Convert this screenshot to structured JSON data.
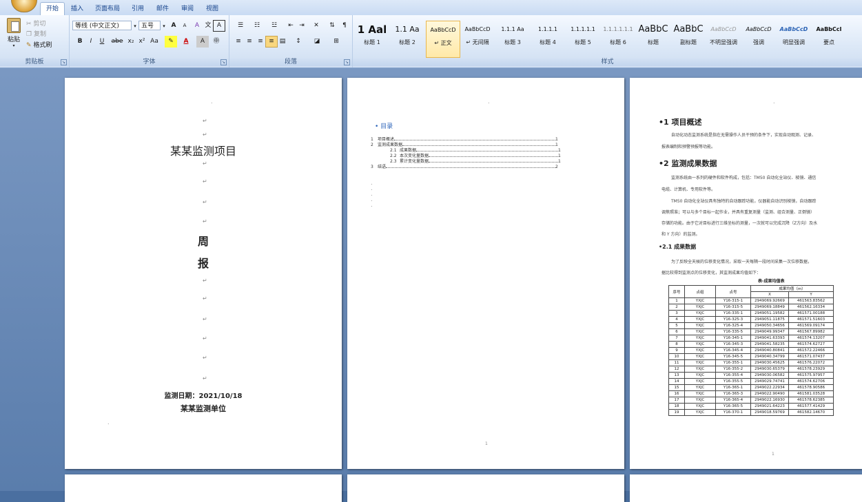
{
  "tabs": [
    "开始",
    "插入",
    "页面布局",
    "引用",
    "邮件",
    "审阅",
    "视图"
  ],
  "clipboard": {
    "paste": "粘贴",
    "cut": "剪切",
    "copy": "复制",
    "format_painter": "格式刷",
    "label": "剪贴板"
  },
  "font": {
    "name": "等线 (中文正文)",
    "size": "五号",
    "label": "字体",
    "bold": "B",
    "italic": "I",
    "underline": "U",
    "strike": "abe",
    "subscript": "x₂",
    "superscript": "x²",
    "change_case": "Aa",
    "grow": "A",
    "shrink": "A",
    "clear": "A",
    "phonetic": "文",
    "border_char": "A",
    "enclose": "A"
  },
  "paragraph": {
    "label": "段落"
  },
  "styles": {
    "label": "样式",
    "items": [
      {
        "preview": "1 Aal",
        "name": "标题 1"
      },
      {
        "preview": "1.1 Aa",
        "name": "标题 2"
      },
      {
        "preview": "AaBbCcD",
        "name": "↵ 正文"
      },
      {
        "preview": "AaBbCcD",
        "name": "↵ 无间隔"
      },
      {
        "preview": "1.1.1 Aa",
        "name": "标题 3"
      },
      {
        "preview": "1.1.1.1",
        "name": "标题 4"
      },
      {
        "preview": "1.1.1.1.1",
        "name": "标题 5"
      },
      {
        "preview": "1.1.1.1.1.1",
        "name": "标题 6"
      },
      {
        "preview": "AaBbC",
        "name": "标题"
      },
      {
        "preview": "AaBbC",
        "name": "副标题"
      },
      {
        "preview": "AaBbCcD",
        "name": "不明显强调"
      },
      {
        "preview": "AaBbCcD",
        "name": "强调"
      },
      {
        "preview": "AaBbCcD",
        "name": "明显强调"
      },
      {
        "preview": "AaBbCcI",
        "name": "要点"
      }
    ]
  },
  "cover": {
    "title": "某某监测项目",
    "big1": "周",
    "big2": "报",
    "date": "监测日期：2021/10/18",
    "org": "某某监测单位"
  },
  "toc": {
    "title": "目录",
    "rows": [
      {
        "num": "1",
        "text": "项目概述",
        "page": "1"
      },
      {
        "num": "2",
        "text": "监测成果数据",
        "page": "1"
      },
      {
        "num": "2.1",
        "text": "成果数据",
        "page": "1"
      },
      {
        "num": "2.2",
        "text": "本次变化量数据",
        "page": "1"
      },
      {
        "num": "2.3",
        "text": "累计变化量数据",
        "page": "1"
      },
      {
        "num": "3",
        "text": "结语",
        "page": "2"
      }
    ],
    "footer": "1"
  },
  "p3": {
    "h1": "1  项目概述",
    "t1": "自动化动态监测系统是指在无需操作人员干预的条件下，实现自动观测、记录、",
    "t1b": "报表编制和预警预报等功能。",
    "h2": "2  监测成果数据",
    "t2": "监测系统由一系列的硬件和软件构成，包括：TM50 自动化全站仪、棱镜、通信",
    "t2b": "电缆、计算机、专用软件等。",
    "t3": "TM50 自动化全站仪具有独特的自动跟踪功能，仪器能自动识别棱镜，自动跟踪",
    "t3b": "调焦照准；可以与多个目标一起作业，并具有重复测量（监测、组合测量、正倒镜）",
    "t3c": "存储的功能。由于它对目标进行三维坐标的测量，一次就可以完成沉降（Z方向）及水",
    "t3d": "和 Y 方向）的监测。",
    "h3": "2.1 成果数据",
    "t4": "为了反映全天候的位移变化情况，采取一天每隔一段时间采集一次位移数据，",
    "t4b": "据比较得到监测点的位移变化，其监测成果均值如下：",
    "caption": "表-成果均值表",
    "footer": "1",
    "headers": {
      "seq": "序号",
      "group": "点组",
      "point": "点号",
      "result": "成果均值（m）",
      "x": "X",
      "y": "Y"
    },
    "rows": [
      [
        "1",
        "YXJC",
        "Y16-315-1",
        "2949069.92669",
        "461563.83562"
      ],
      [
        "2",
        "YXJC",
        "Y16-315-5",
        "2949069.18849",
        "461562.16334"
      ],
      [
        "3",
        "YXJC",
        "Y16-335-1",
        "2949051.19582",
        "461571.00188"
      ],
      [
        "4",
        "YXJC",
        "Y16-325-3",
        "2949051.11875",
        "461571.51603"
      ],
      [
        "5",
        "YXJC",
        "Y16-325-4",
        "2949050.34656",
        "461569.09174"
      ],
      [
        "6",
        "YXJC",
        "Y16-335-5",
        "2949049.99347",
        "461567.89982"
      ],
      [
        "7",
        "YXJC",
        "Y16-345-1",
        "2949041.63393",
        "461574.13207"
      ],
      [
        "8",
        "YXJC",
        "Y16-345-3",
        "2949041.58235",
        "461574.62727"
      ],
      [
        "9",
        "YXJC",
        "Y16-345-4",
        "2949040.80841",
        "461572.22466"
      ],
      [
        "10",
        "YXJC",
        "Y16-345-5",
        "2949040.34799",
        "461571.07437"
      ],
      [
        "11",
        "YXJC",
        "Y16-355-1",
        "2949030.45625",
        "461576.22072"
      ],
      [
        "12",
        "YXJC",
        "Y16-355-2",
        "2949030.65379",
        "461578.23929"
      ],
      [
        "13",
        "YXJC",
        "Y16-355-4",
        "2949030.06582",
        "461575.97957"
      ],
      [
        "14",
        "YXJC",
        "Y16-355-5",
        "2949029.74741",
        "461574.62706"
      ],
      [
        "15",
        "YXJC",
        "Y16-365-1",
        "2949022.22934",
        "461578.90586"
      ],
      [
        "16",
        "YXJC",
        "Y16-365-3",
        "2949022.90490",
        "461581.03528"
      ],
      [
        "17",
        "YXJC",
        "Y16-365-4",
        "2949022.16930",
        "461578.62385"
      ],
      [
        "18",
        "YXJC",
        "Y16-365-5",
        "2949021.64223",
        "461577.41429"
      ],
      [
        "19",
        "YXJC",
        "Y16-370-1",
        "2949018.59769",
        "461582.14670"
      ]
    ]
  }
}
